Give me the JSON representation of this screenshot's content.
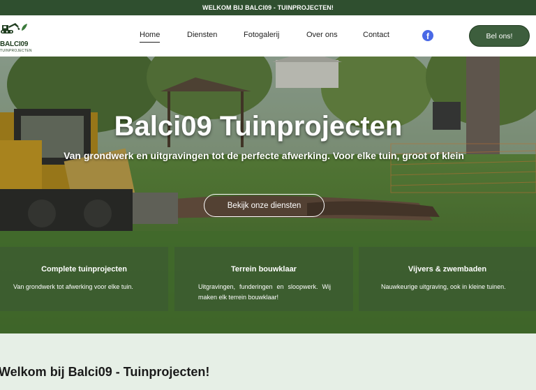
{
  "topbar": {
    "text": "WELKOM BIJ BALCI09 - TUINPROJECTEN!"
  },
  "brand": {
    "name": "BALCI09",
    "tagline": "TUINPROJECTEN",
    "logo_icon": "excavator-icon"
  },
  "nav": {
    "items": [
      {
        "label": "Home",
        "active": true
      },
      {
        "label": "Diensten"
      },
      {
        "label": "Fotogalerij"
      },
      {
        "label": "Over ons"
      },
      {
        "label": "Contact"
      }
    ],
    "social_icon": "facebook-icon",
    "cta_label": "Bel ons!"
  },
  "hero": {
    "title": "Balci09 Tuinprojecten",
    "subtitle": "Van grondwerk en uitgravingen tot de perfecte afwerking. Voor elke tuin, groot of klein",
    "button_label": "Bekijk onze diensten"
  },
  "cards": [
    {
      "title": "Complete tuinprojecten",
      "text": "Van grondwerk tot afwerking voor elke tuin."
    },
    {
      "title": "Terrein bouwklaar",
      "text": "Uitgravingen, funderingen en sloopwerk. Wij maken elk terrein bouwklaar!"
    },
    {
      "title": "Vijvers & zwembaden",
      "text": "Nauwkeurige uitgraving, ook in kleine tuinen."
    }
  ],
  "welcome": {
    "title": "Welkom bij Balci09 - Tuinprojecten!"
  },
  "colors": {
    "topbar": "#2f4f2f",
    "accent": "#3d5e3d",
    "facebook": "#4a69e6",
    "section_bg": "#e6efe6"
  }
}
